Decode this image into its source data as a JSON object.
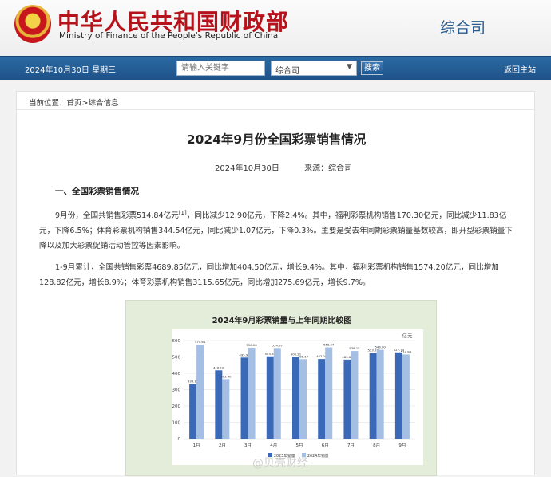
{
  "header": {
    "site_title": "中华人民共和国财政部",
    "site_subtitle": "Ministry of Finance of the People's Republic of China",
    "department": "综合司"
  },
  "navbar": {
    "date": "2024年10月30日  星期三",
    "search_placeholder": "请输入关键字",
    "select_value": "综合司",
    "search_button": "搜索",
    "home_link": "返回主站"
  },
  "breadcrumb": "当前位置：首页>综合信息",
  "article": {
    "title": "2024年9月份全国彩票销售情况",
    "date": "2024年10月30日",
    "source": "来源：综合司",
    "section1": "一、全国彩票销售情况",
    "para1_a": "9月份，全国共销售彩票514.84亿元",
    "para1_sup": "[1]",
    "para1_b": "，同比减少12.90亿元，下降2.4%。其中，福利彩票机构销售170.30亿元，同比减少11.83亿元，下降6.5%；体育彩票机构销售344.54亿元，同比减少1.07亿元，下降0.3%。主要是受去年同期彩票销量基数较高，即开型彩票销量下降以及加大彩票促销活动管控等因素影响。",
    "para2": "1-9月累计，全国共销售彩票4689.85亿元，同比增加404.50亿元，增长9.4%。其中，福利彩票机构销售1574.20亿元，同比增加128.82亿元，增长8.9%；体育彩票机构销售3115.65亿元，同比增加275.69亿元，增长9.7%。"
  },
  "watermark": "@贝壳财经",
  "colors": {
    "bar_2023": "#3a6ab7",
    "bar_2024": "#a4bfe3",
    "title_red": "#b5121b",
    "nav_blue": "#1e5288"
  },
  "chart_data": {
    "type": "bar",
    "title": "2024年9月彩票销量与上年同期比较图",
    "unit_label": "亿元",
    "categories": [
      "1月",
      "2月",
      "3月",
      "4月",
      "5月",
      "6月",
      "7月",
      "8月",
      "9月"
    ],
    "ylim": [
      0,
      600
    ],
    "yticks": [
      0,
      100,
      200,
      300,
      400,
      500,
      600
    ],
    "legend_position": "bottom",
    "series": [
      {
        "name": "2023年销量",
        "values": [
          333.15,
          418.1,
          495.92,
          503.58,
          500.21,
          487.26,
          483.61,
          523.57,
          527.74
        ]
      },
      {
        "name": "2024年销量",
        "values": [
          575.64,
          363.9,
          556.0,
          554.37,
          486.17,
          558.27,
          536.15,
          543.0,
          514.84
        ]
      }
    ]
  }
}
